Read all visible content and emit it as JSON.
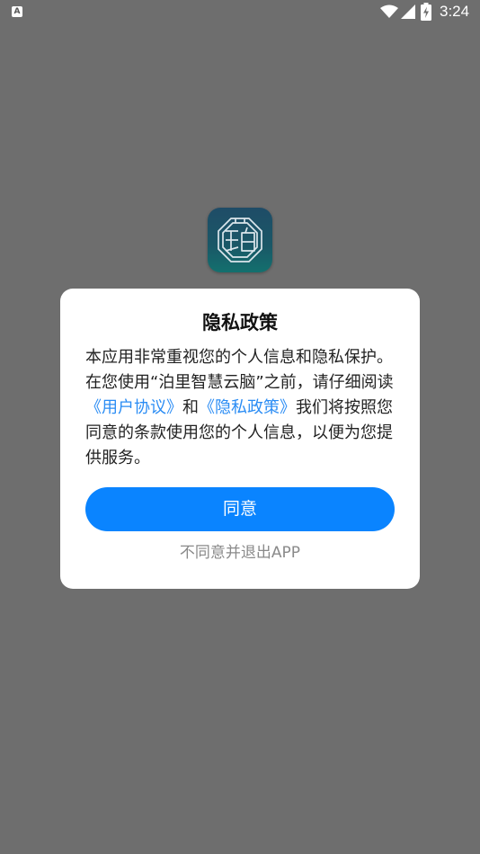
{
  "status_bar": {
    "notification_icon_letter": "A",
    "time": "3:24",
    "icons": [
      "notification-a-icon",
      "wifi-icon",
      "cell-signal-icon",
      "battery-charging-icon"
    ]
  },
  "app": {
    "logo_icon": "bo-app-logo-icon"
  },
  "dialog": {
    "title": "隐私政策",
    "body_part1": "本应用非常重视您的个人信息和隐私保护。在您使用“泊里智慧云脑”之前，请仔细阅读",
    "user_agreement_link": "《用户协议》",
    "body_and": "和",
    "privacy_policy_link": "《隐私政策》",
    "body_part2": "我们将按照您同意的条款使用您的个人信息，以便为您提供服务。",
    "agree_button": "同意",
    "disagree_link": "不同意并退出APP"
  },
  "colors": {
    "overlay": "#6e6e6e",
    "primary_button": "#0a84ff",
    "link": "#2a8cf4",
    "secondary_text": "#8a8a8a"
  }
}
